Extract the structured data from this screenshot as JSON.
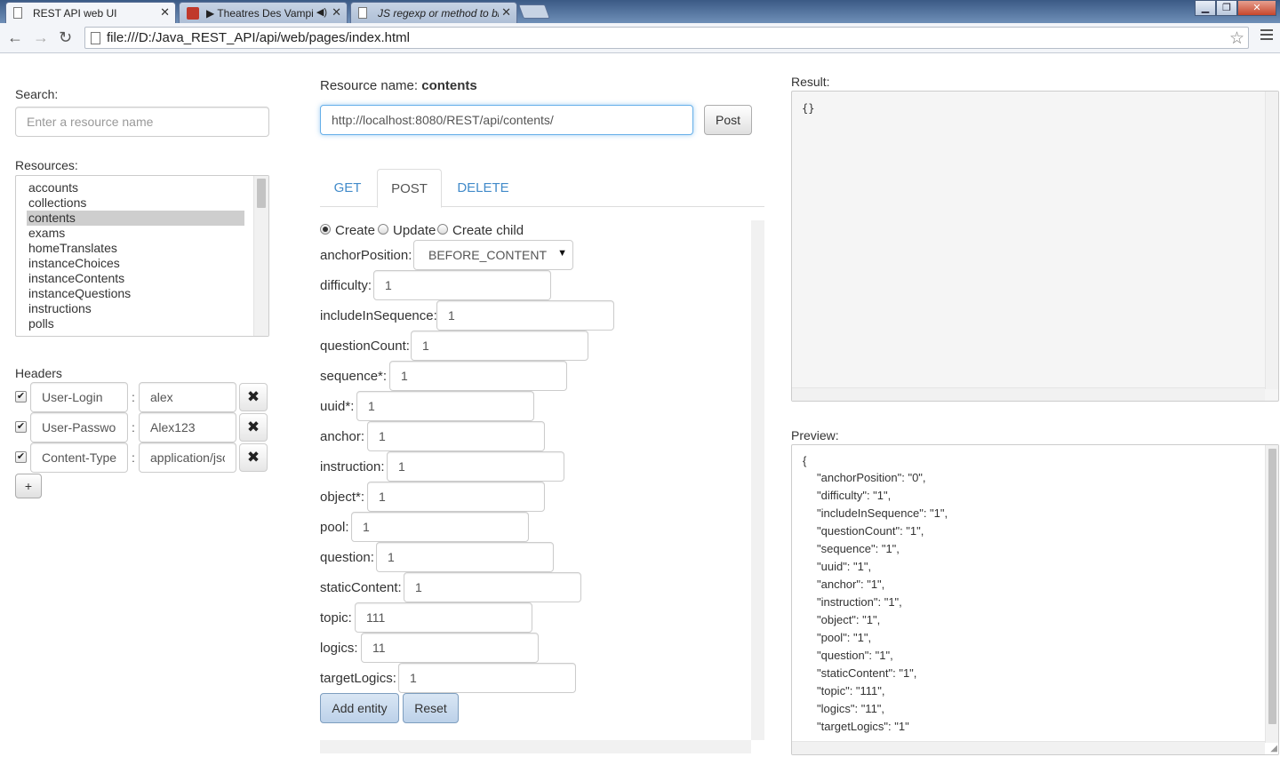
{
  "browser": {
    "tabs": [
      {
        "title": "REST API web UI"
      },
      {
        "title": "▶ Theatres Des Vampi"
      },
      {
        "title": "JS regexp or method to bi"
      }
    ],
    "url": "file:///D:/Java_REST_API/api/web/pages/index.html"
  },
  "search": {
    "label": "Search:",
    "placeholder": "Enter a resource name"
  },
  "resources": {
    "label": "Resources:",
    "items": [
      "accounts",
      "collections",
      "contents",
      "exams",
      "homeTranslates",
      "instanceChoices",
      "instanceContents",
      "instanceQuestions",
      "instructions",
      "polls"
    ],
    "selected": "contents"
  },
  "headers": {
    "label": "Headers",
    "rows": [
      {
        "key": "User-Login",
        "value": "alex"
      },
      {
        "key": "User-Passwor",
        "value": "Alex123"
      },
      {
        "key": "Content-Type",
        "value": "application/jso"
      }
    ],
    "separator": ":",
    "remove_label": "✖",
    "add_label": "+"
  },
  "resource": {
    "name_label": "Resource name:",
    "name": "contents",
    "url": "http://localhost:8080/REST/api/contents/",
    "method_button": "Post"
  },
  "method_tabs": [
    "GET",
    "POST",
    "DELETE"
  ],
  "active_tab": "POST",
  "modes": [
    "Create",
    "Update",
    "Create child"
  ],
  "selected_mode": "Create",
  "form": {
    "anchor_position": {
      "label": "anchorPosition:",
      "value": "BEFORE_CONTENT"
    },
    "fields": [
      {
        "label": "difficulty:",
        "value": "1"
      },
      {
        "label": "includeInSequence:",
        "value": "1"
      },
      {
        "label": "questionCount:",
        "value": "1"
      },
      {
        "label": "sequence*:",
        "value": "1"
      },
      {
        "label": "uuid*:",
        "value": "1"
      },
      {
        "label": "anchor:",
        "value": "1"
      },
      {
        "label": "instruction:",
        "value": "1"
      },
      {
        "label": "object*:",
        "value": "1"
      },
      {
        "label": "pool:",
        "value": "1"
      },
      {
        "label": "question:",
        "value": "1"
      },
      {
        "label": "staticContent:",
        "value": "1"
      },
      {
        "label": "topic:",
        "value": "111"
      },
      {
        "label": "logics:",
        "value": "11"
      },
      {
        "label": "targetLogics:",
        "value": "1"
      }
    ],
    "add_label": "Add entity",
    "reset_label": "Reset"
  },
  "result": {
    "label": "Result:",
    "text": "{}"
  },
  "preview": {
    "label": "Preview:",
    "lines": [
      "{",
      "\"anchorPosition\": \"0\",",
      "\"difficulty\": \"1\",",
      "\"includeInSequence\": \"1\",",
      "\"questionCount\": \"1\",",
      "\"sequence\": \"1\",",
      "\"uuid\": \"1\",",
      "\"anchor\": \"1\",",
      "\"instruction\": \"1\",",
      "\"object\": \"1\",",
      "\"pool\": \"1\",",
      "\"question\": \"1\",",
      "\"staticContent\": \"1\",",
      "\"topic\": \"111\",",
      "\"logics\": \"11\",",
      "\"targetLogics\": \"1\""
    ]
  }
}
